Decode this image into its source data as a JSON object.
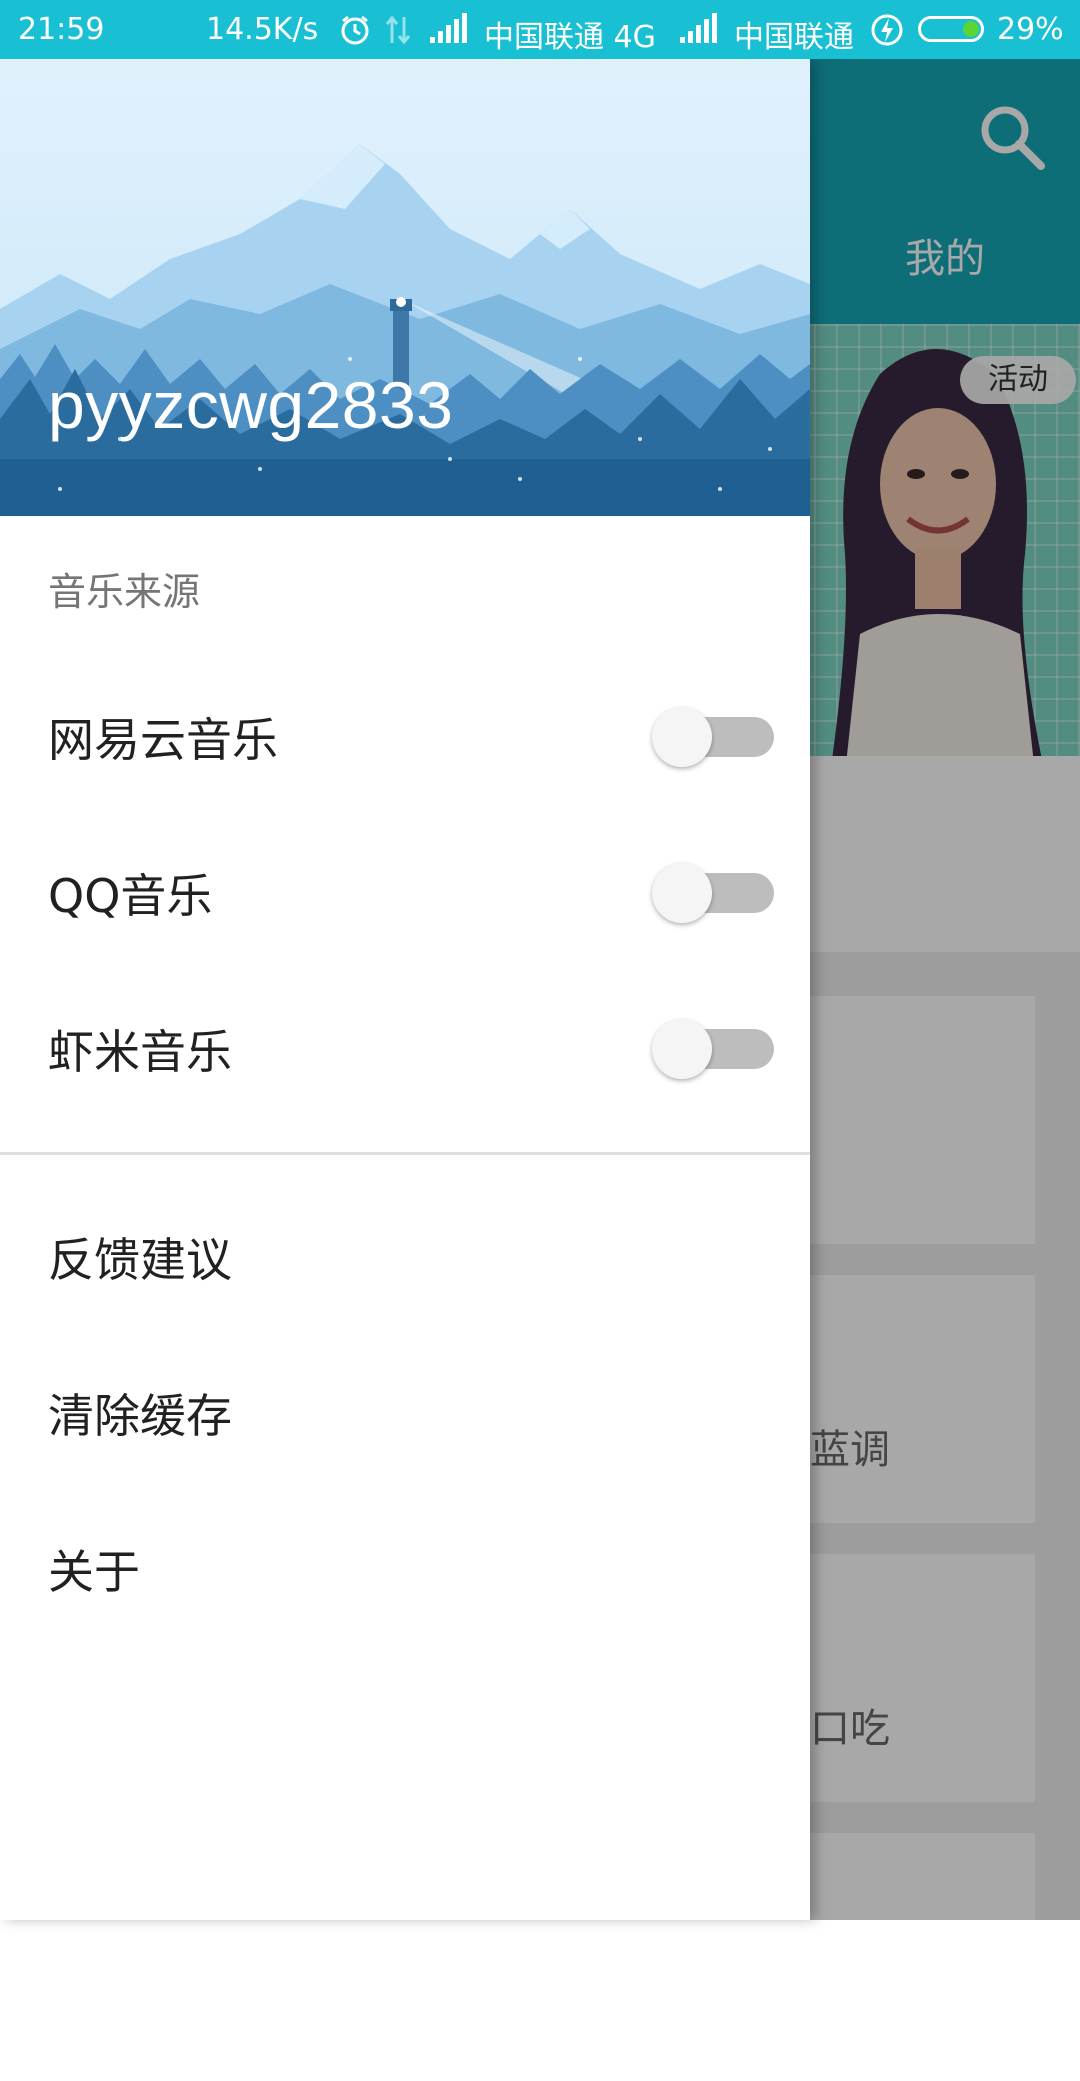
{
  "status_bar": {
    "time": "21:59",
    "net_speed": "14.5K/s",
    "carrier_1": "中国联通 4G",
    "carrier_2": "中国联通",
    "battery": "29%",
    "battery_color": "#5bd434"
  },
  "background_app": {
    "tab_mine": "我的",
    "banner_badge": "活动",
    "card_texts": [
      "部蓝调",
      "的口吃"
    ],
    "toolbar_color": "#16a8b7"
  },
  "drawer": {
    "username": "pyyzcwg2833",
    "section_title": "音乐来源",
    "sources": [
      {
        "label": "网易云音乐",
        "enabled": false
      },
      {
        "label": "QQ音乐",
        "enabled": false
      },
      {
        "label": "虾米音乐",
        "enabled": false
      }
    ],
    "actions": [
      {
        "label": "反馈建议"
      },
      {
        "label": "清除缓存"
      },
      {
        "label": "关于"
      }
    ]
  }
}
